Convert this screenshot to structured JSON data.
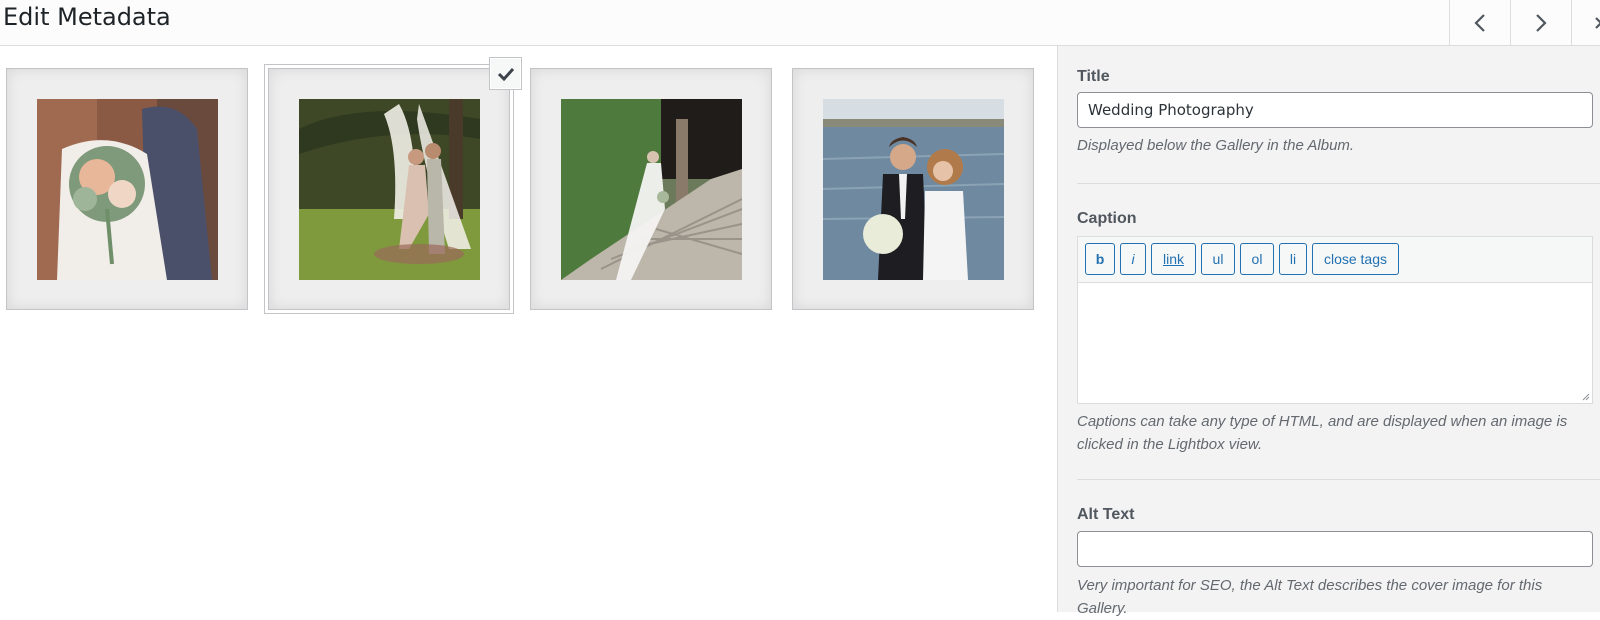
{
  "header": {
    "title": "Edit Metadata",
    "prev_icon": "chevron-left-icon",
    "next_icon": "chevron-right-icon",
    "close_icon": "close-icon"
  },
  "gallery": {
    "images": [
      {
        "subject": "bride-bouquet",
        "selected": false
      },
      {
        "subject": "couple-under-tree",
        "selected": true
      },
      {
        "subject": "bride-on-stairs",
        "selected": false
      },
      {
        "subject": "couple-by-lake",
        "selected": false
      }
    ]
  },
  "sidebar": {
    "title_label": "Title",
    "title_value": "Wedding Photography",
    "title_desc": "Displayed below the Gallery in the Album.",
    "caption_label": "Caption",
    "caption_buttons": [
      "b",
      "i",
      "link",
      "ul",
      "ol",
      "li",
      "close tags"
    ],
    "caption_value": "",
    "caption_desc": "Captions can take any type of HTML, and are displayed when an image is clicked in the Lightbox view.",
    "alt_label": "Alt Text",
    "alt_value": "",
    "alt_desc": "Very important for SEO, the Alt Text describes the cover image for this Gallery."
  },
  "colors": {
    "accent": "#2271b1",
    "sidebar_bg": "#f3f3f3",
    "desc_text": "#646970"
  }
}
